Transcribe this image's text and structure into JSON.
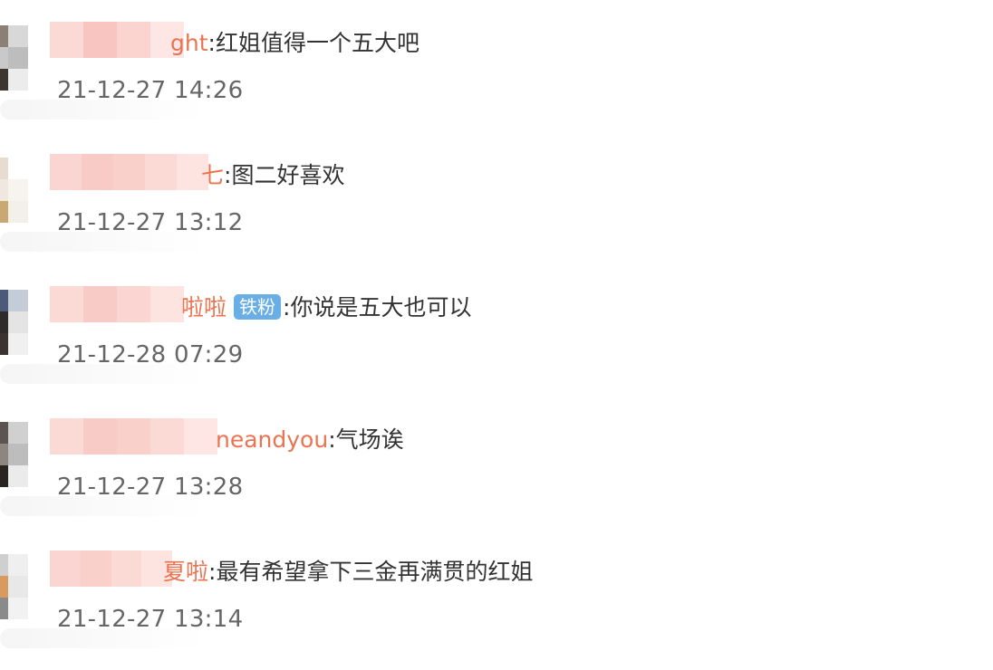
{
  "comments": [
    {
      "username_visible": "ght",
      "text": "红姐值得一个五大吧",
      "time": "21-12-27 14:26"
    },
    {
      "username_visible": "七",
      "text": "图二好喜欢",
      "time": "21-12-27 13:12"
    },
    {
      "username_visible": "啦啦",
      "badge": "铁粉",
      "text": "你说是五大也可以",
      "time": "21-12-28 07:29"
    },
    {
      "username_visible": "neandyou",
      "text": "气场诶",
      "time": "21-12-27 13:28"
    },
    {
      "username_visible": "夏啦",
      "text": "最有希望拿下三金再满贯的红姐",
      "time": "21-12-27 13:14"
    }
  ],
  "separator": ":",
  "colors": {
    "username": "#eb7350",
    "text": "#333333",
    "time": "#666666",
    "badge_bg": "#6aaee6",
    "mosaic": "#f9c9c4"
  }
}
